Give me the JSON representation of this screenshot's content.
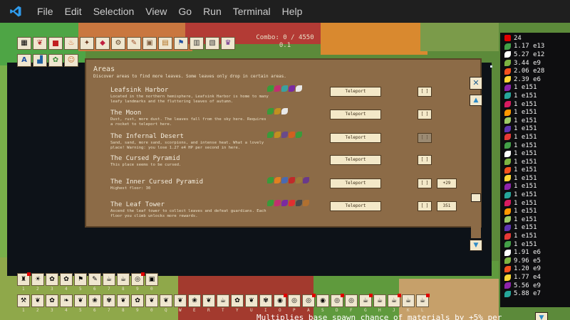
{
  "menubar": {
    "items": [
      "File",
      "Edit",
      "Selection",
      "View",
      "Go",
      "Run",
      "Terminal",
      "Help"
    ]
  },
  "colors": {
    "panel": "#8c6b47",
    "button": "#f3e8c8",
    "accent_blue": "#1e88e5",
    "badge_red": "#e00000"
  },
  "game": {
    "combo": "Combo: 0 / 4550",
    "combo_sub": "0.1",
    "resources": [
      {
        "value": "24",
        "icon": "red-square"
      },
      {
        "value": "1.17 e13",
        "icon": "leaf"
      },
      {
        "value": "5.27 e12",
        "icon": "leaf"
      },
      {
        "value": "3.44 e9",
        "icon": "leaf"
      },
      {
        "value": "2.06 e28",
        "icon": "leaf"
      },
      {
        "value": "2.39 e6",
        "icon": "leaf"
      },
      {
        "value": "1 e151",
        "icon": "leaf"
      },
      {
        "value": "1 e151",
        "icon": "leaf"
      },
      {
        "value": "1 e151",
        "icon": "leaf"
      },
      {
        "value": "1 e151",
        "icon": "leaf"
      },
      {
        "value": "1 e151",
        "icon": "leaf"
      },
      {
        "value": "1 e151",
        "icon": "leaf"
      },
      {
        "value": "1 e151",
        "icon": "leaf"
      },
      {
        "value": "1 e151",
        "icon": "leaf"
      },
      {
        "value": "1 e151",
        "icon": "leaf"
      },
      {
        "value": "1 e151",
        "icon": "leaf"
      },
      {
        "value": "1 e151",
        "icon": "leaf"
      },
      {
        "value": "1 e151",
        "icon": "leaf"
      },
      {
        "value": "1 e151",
        "icon": "leaf"
      },
      {
        "value": "1 e151",
        "icon": "leaf"
      },
      {
        "value": "1 e151",
        "icon": "leaf"
      },
      {
        "value": "1 e151",
        "icon": "leaf"
      },
      {
        "value": "1 e151",
        "icon": "leaf"
      },
      {
        "value": "1 e151",
        "icon": "leaf"
      },
      {
        "value": "1 e151",
        "icon": "leaf"
      },
      {
        "value": "1 e151",
        "icon": "leaf"
      },
      {
        "value": "1.91 e6",
        "icon": "leaf"
      },
      {
        "value": "9.96 e5",
        "icon": "leaf"
      },
      {
        "value": "1.20 e9",
        "icon": "leaf"
      },
      {
        "value": "1.77 e4",
        "icon": "leaf"
      },
      {
        "value": "5.56 e9",
        "icon": "leaf"
      },
      {
        "value": "5.88 e7",
        "icon": "leaf"
      }
    ],
    "areas_panel": {
      "title": "Areas",
      "description": "Discover areas to find more leaves. Some leaves only drop in certain areas.",
      "areas": [
        {
          "name": "Leafsink Harbor",
          "description": "Located in the northern hemisphere, Leafsink Harbor is home to many leafy landmarks and the fluttering leaves of autumn.",
          "teleport_label": "Teleport",
          "btn": "[ ]",
          "extra_btn": ""
        },
        {
          "name": "The Moon",
          "description": "Dust, rust, more dust. The leaves fall from the sky here. Requires a rocket to teleport here.",
          "teleport_label": "Teleport",
          "btn": "[ ]",
          "extra_btn": ""
        },
        {
          "name": "The Infernal Desert",
          "description": "Sand, sand, more sand, scorpions, and intense heat. What a lovely place! Warning: you lose 1.27 e4 HP per second in here.",
          "teleport_label": "Teleport",
          "btn": "[ ]",
          "extra_btn": ""
        },
        {
          "name": "The Cursed Pyramid",
          "description": "This place seems to be cursed.",
          "teleport_label": "Teleport",
          "btn": "[ ]",
          "extra_btn": ""
        },
        {
          "name": "The Inner Cursed Pyramid",
          "description": "Highest floor: 30",
          "teleport_label": "Teleport",
          "btn": "[ ]",
          "extra_btn": "+29"
        },
        {
          "name": "The Leaf Tower",
          "description": "Ascend the leaf tower to collect leaves and defeat guardians. Each floor you climb unlocks more rewards.",
          "teleport_label": "Teleport",
          "btn": "[ ]",
          "extra_btn": "351"
        }
      ]
    },
    "bottom_message": "Multiplies base spawn chance of materials by +5% per",
    "bottom_row_1_keys": [
      "1",
      "2",
      "3",
      "4",
      "5",
      "6",
      "7",
      "8",
      "9",
      "0"
    ],
    "bottom_row_2_keys": [
      "1",
      "2",
      "3",
      "4",
      "5",
      "6",
      "7",
      "8",
      "9",
      "0",
      "Q",
      "W",
      "E",
      "R",
      "T",
      "Y",
      "U",
      "I",
      "O",
      "P",
      "A",
      "S",
      "D",
      "F",
      "G",
      "H",
      "J",
      "K",
      "L"
    ]
  }
}
